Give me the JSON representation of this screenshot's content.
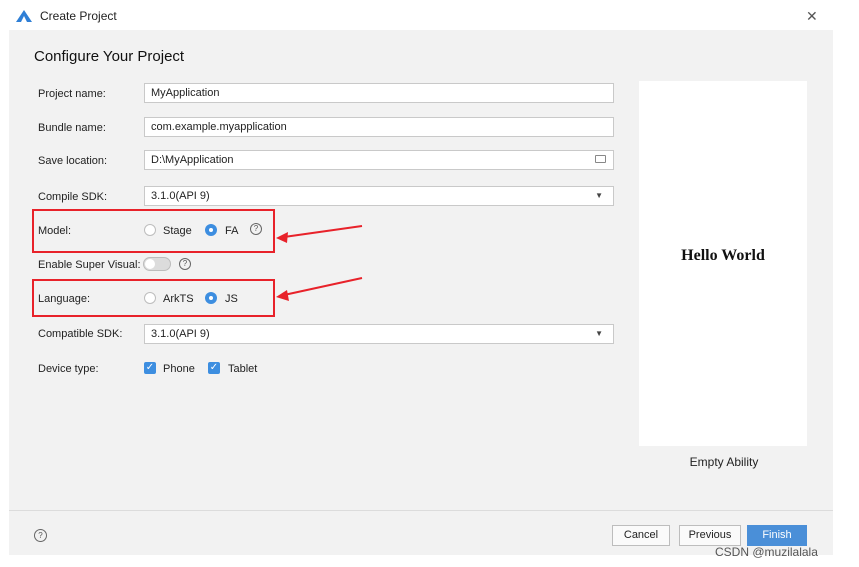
{
  "window": {
    "title": "Create Project",
    "close_glyph": "✕"
  },
  "heading": "Configure Your Project",
  "form": {
    "project_name": {
      "label": "Project name:",
      "value": "MyApplication"
    },
    "bundle_name": {
      "label": "Bundle name:",
      "value": "com.example.myapplication"
    },
    "save_location": {
      "label": "Save location:",
      "value": "D:\\MyApplication"
    },
    "compile_sdk": {
      "label": "Compile SDK:",
      "value": "3.1.0(API 9)"
    },
    "model": {
      "label": "Model:",
      "options": [
        "Stage",
        "FA"
      ],
      "selected": "FA"
    },
    "super_visual": {
      "label": "Enable Super Visual:",
      "enabled": false
    },
    "language": {
      "label": "Language:",
      "options": [
        "ArkTS",
        "JS"
      ],
      "selected": "JS"
    },
    "compatible_sdk": {
      "label": "Compatible SDK:",
      "value": "3.1.0(API 9)"
    },
    "device_type": {
      "label": "Device type:",
      "options": [
        "Phone",
        "Tablet"
      ],
      "checked": [
        "Phone",
        "Tablet"
      ]
    }
  },
  "preview": {
    "text": "Hello World",
    "template_name": "Empty Ability"
  },
  "footer": {
    "cancel": "Cancel",
    "previous": "Previous",
    "finish": "Finish"
  },
  "watermark": "CSDN @muzilalala",
  "icons": {
    "help": "?",
    "dropdown": "▼",
    "check": "✓"
  },
  "colors": {
    "accent": "#3d8ee0",
    "highlight": "#e8222a",
    "dialog_bg": "#f2f2f2"
  }
}
